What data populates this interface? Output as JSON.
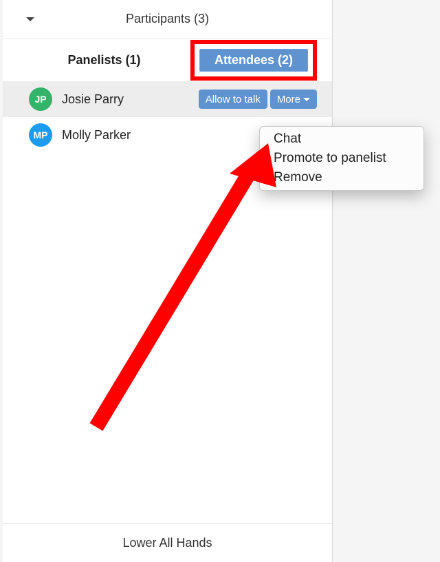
{
  "header": {
    "title": "Participants (3)"
  },
  "tabs": {
    "panelists": "Panelists (1)",
    "attendees": "Attendees (2)"
  },
  "attendees": [
    {
      "initials": "JP",
      "name": "Josie Parry",
      "avatar_color": "#34b36a",
      "selected": true,
      "actions": {
        "allow_talk": "Allow to talk",
        "more": "More"
      }
    },
    {
      "initials": "MP",
      "name": "Molly Parker",
      "avatar_color": "#1a9cf0",
      "selected": false
    }
  ],
  "context_menu": {
    "items": [
      "Chat",
      "Promote to panelist",
      "Remove"
    ]
  },
  "footer": {
    "lower_all_hands": "Lower All Hands"
  }
}
